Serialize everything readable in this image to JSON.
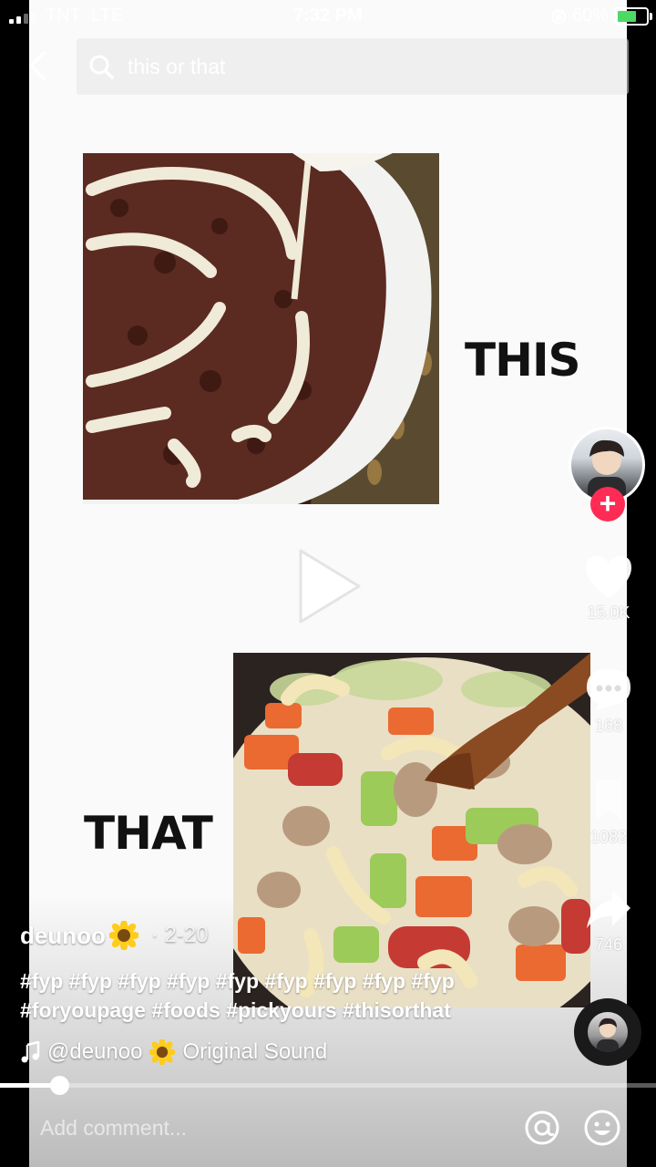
{
  "status_bar": {
    "carrier": "TNT",
    "network": "LTE",
    "time": "7:32 PM",
    "battery": "60%"
  },
  "search": {
    "placeholder": "this or that"
  },
  "content": {
    "word_top": "THIS",
    "word_bottom": "THAT"
  },
  "actions": {
    "likes": "15.0K",
    "comments": "168",
    "saves": "1083",
    "shares": "746"
  },
  "caption": {
    "username": "deunoo",
    "date": "· 2-20",
    "hashtags": "#fyp #fyp #fyp #fyp #fyp #fyp #fyp #fyp #fyp #foryoupage #foods #pickyours #thisorthat",
    "sound": "@deunoo",
    "sound_suffix": "Original Sound"
  },
  "playback": {
    "progress": 0.09
  },
  "comment": {
    "placeholder": "Add comment..."
  },
  "colors": {
    "accent": "#fe2c55",
    "battery": "#4cd964"
  },
  "icons": [
    "back-arrow-icon",
    "search-icon",
    "play-icon",
    "heart-icon",
    "comment-icon",
    "bookmark-icon",
    "share-icon",
    "music-note-icon",
    "sunflower-icon",
    "at-icon",
    "emoji-icon"
  ]
}
